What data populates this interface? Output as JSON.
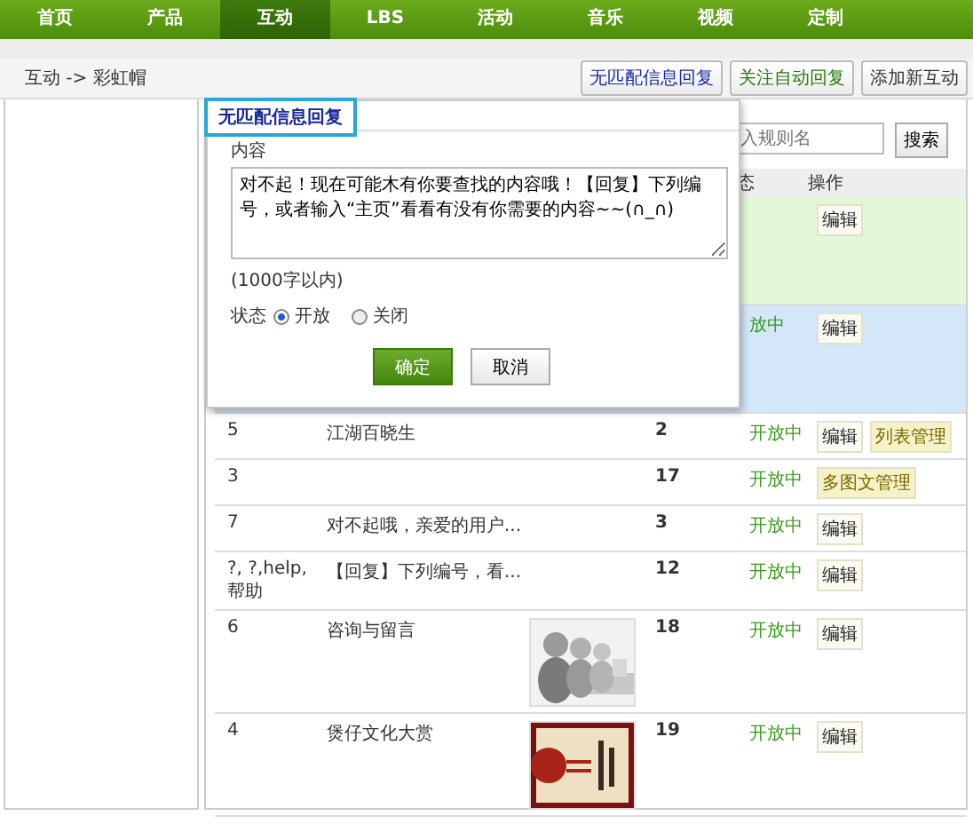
{
  "nav": [
    {
      "label": "首页",
      "selected": false
    },
    {
      "label": "产品",
      "selected": false
    },
    {
      "label": "互动",
      "selected": true
    },
    {
      "label": "LBS",
      "selected": false
    },
    {
      "label": "活动",
      "selected": false
    },
    {
      "label": "音乐",
      "selected": false
    },
    {
      "label": "视频",
      "selected": false
    },
    {
      "label": "定制",
      "selected": false
    }
  ],
  "breadcrumb": "互动 -> 彩虹帽",
  "header_buttons": [
    {
      "label": "无匹配信息回复",
      "color": "#1c2a9c"
    },
    {
      "label": "关注自动回复",
      "color": "#2a7a12"
    },
    {
      "label": "添加新互动",
      "color": "#333333"
    }
  ],
  "search": {
    "placeholder": "入规则名",
    "button": "搜索"
  },
  "table": {
    "columns": {
      "status": "态",
      "actions": "操作"
    },
    "rows": [
      {
        "color": "#e4f8d8",
        "actions": [
          {
            "label": "编辑",
            "kind": "edit"
          }
        ]
      },
      {
        "color": "#d4e7f8",
        "status": "放中",
        "actions": [
          {
            "label": "编辑",
            "kind": "edit"
          }
        ]
      },
      {
        "id": "5",
        "name": "江湖百晓生",
        "count": "2",
        "status": "开放中",
        "actions": [
          {
            "label": "编辑",
            "kind": "edit"
          },
          {
            "label": "列表管理",
            "kind": "manage"
          }
        ]
      },
      {
        "id": "3",
        "count": "17",
        "status": "开放中",
        "actions": [
          {
            "label": "多图文管理",
            "kind": "manage"
          }
        ]
      },
      {
        "id": "7",
        "name": "对不起哦，亲爱的用户...",
        "count": "3",
        "status": "开放中",
        "actions": [
          {
            "label": "编辑",
            "kind": "edit"
          }
        ]
      },
      {
        "id": "?, ?,help,帮助",
        "name": "【回复】下列编号，看...",
        "count": "12",
        "status": "开放中",
        "actions": [
          {
            "label": "编辑",
            "kind": "edit"
          }
        ]
      },
      {
        "id": "6",
        "name": "咨询与留言",
        "image": {
          "kind": "picture"
        },
        "count": "18",
        "status": "开放中",
        "actions": [
          {
            "label": "编辑",
            "kind": "edit"
          }
        ]
      },
      {
        "id": "4",
        "name": "煲仔文化大赏",
        "image": {
          "kind": "picture"
        },
        "count": "19",
        "status": "开放中",
        "actions": [
          {
            "label": "编辑",
            "kind": "edit"
          }
        ]
      }
    ]
  },
  "dialog": {
    "tab": "无匹配信息回复",
    "content_label": "内容",
    "content": "对不起！现在可能木有你要查找的内容哦！【回复】下列编号，或者输入“主页”看看有没有你需要的内容~~(∩_∩)",
    "hint": "(1000字以内)",
    "status_label": "状态",
    "options": [
      {
        "label": "开放",
        "selected": true
      },
      {
        "label": "关闭",
        "selected": false
      }
    ],
    "buttons": [
      {
        "label": "确定",
        "kind": "primary"
      },
      {
        "label": "取消",
        "kind": "secondary"
      }
    ]
  }
}
